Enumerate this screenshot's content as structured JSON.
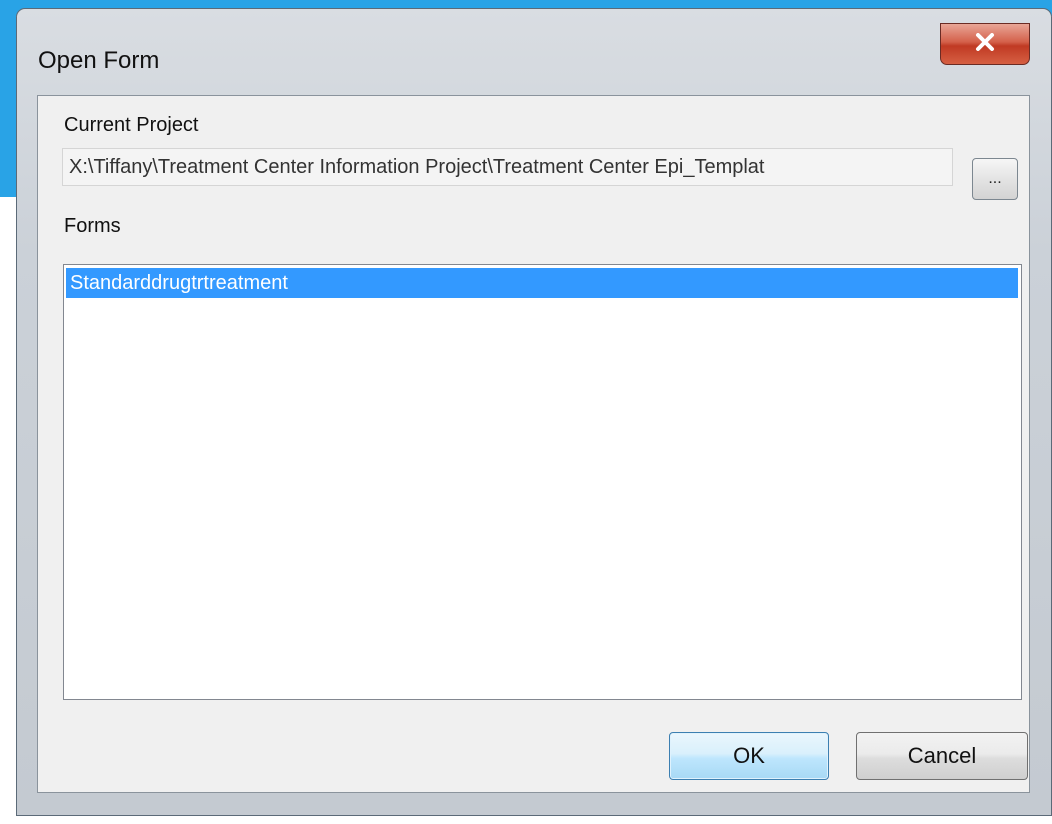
{
  "window": {
    "title": "Open Form",
    "close_symbol": "x"
  },
  "current_project": {
    "label": "Current Project",
    "path": "X:\\Tiffany\\Treatment Center Information Project\\Treatment Center Epi_Templat",
    "browse_label": "..."
  },
  "forms": {
    "label": "Forms",
    "items": [
      {
        "label": "Standarddrugtrtreatment",
        "selected": true
      }
    ]
  },
  "buttons": {
    "ok": "OK",
    "cancel": "Cancel"
  },
  "colors": {
    "background_accent": "#29a3e6",
    "selection": "#3399ff",
    "close_button": "#c94a32"
  }
}
